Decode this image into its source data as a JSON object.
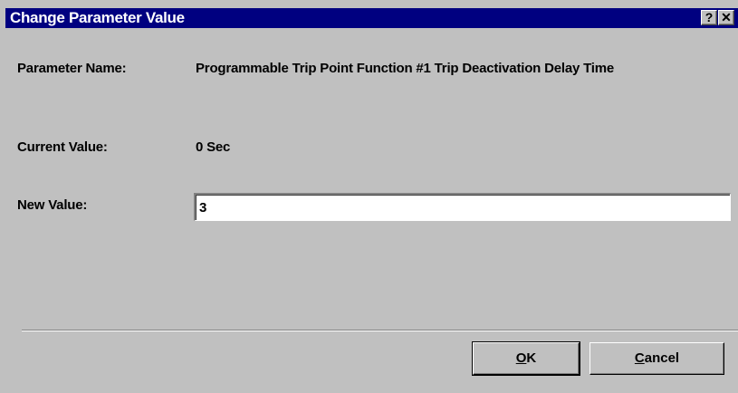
{
  "window": {
    "title": "Change Parameter Value",
    "help_glyph": "?",
    "close_glyph": "✕"
  },
  "form": {
    "parameter_name_label": "Parameter Name:",
    "parameter_name_value": "Programmable Trip Point Function #1 Trip Deactivation Delay Time",
    "current_value_label": "Current Value:",
    "current_value_value": "0 Sec",
    "new_value_label": "New Value:",
    "new_value_input": "3"
  },
  "buttons": {
    "ok_label": "OK",
    "cancel_label": "Cancel"
  },
  "colors": {
    "titlebar": "#000080",
    "dialog_face": "#c0c0c0"
  }
}
